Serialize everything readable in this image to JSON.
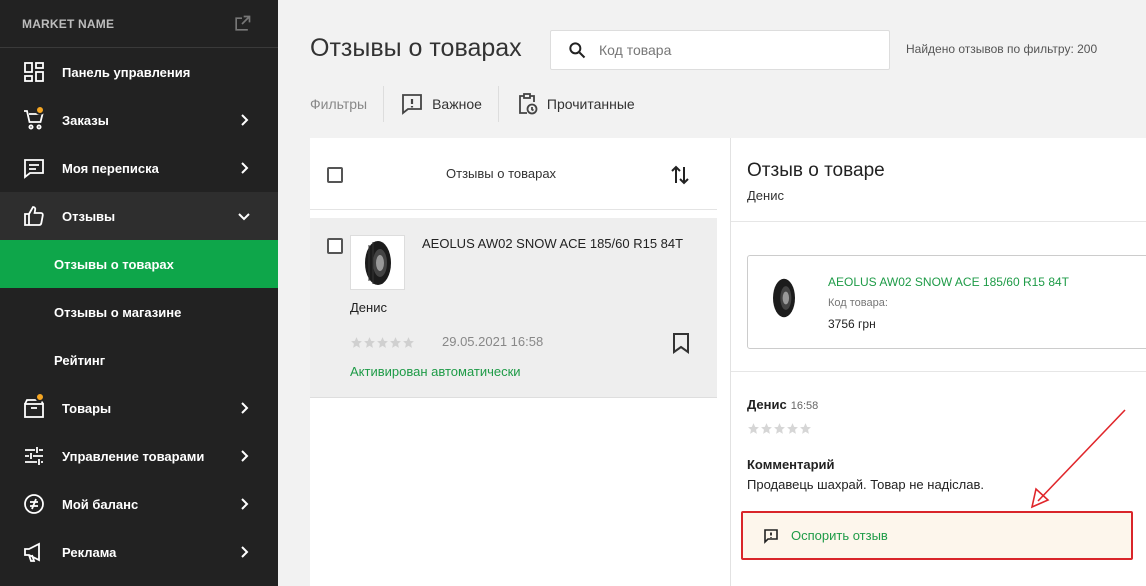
{
  "sidebar": {
    "market_name": "MARKET NAME",
    "items": [
      {
        "label": "Панель управления",
        "icon": "dashboard-icon"
      },
      {
        "label": "Заказы",
        "icon": "cart-icon"
      },
      {
        "label": "Моя переписка",
        "icon": "chat-icon"
      },
      {
        "label": "Отзывы",
        "icon": "thumb-up-icon"
      },
      {
        "label": "Товары",
        "icon": "box-icon"
      },
      {
        "label": "Управление товарами",
        "icon": "sliders-icon"
      },
      {
        "label": "Мой баланс",
        "icon": "balance-icon"
      },
      {
        "label": "Реклама",
        "icon": "megaphone-icon"
      }
    ],
    "sub_items": [
      {
        "label": "Отзывы о товарах"
      },
      {
        "label": "Отзывы о магазине"
      },
      {
        "label": "Рейтинг"
      }
    ]
  },
  "page": {
    "title": "Отзывы о товарах",
    "search_placeholder": "Код товара",
    "found_text": "Найдено отзывов по фильтру: 200"
  },
  "filters": {
    "label": "Фильтры",
    "important": "Важное",
    "read": "Прочитанные"
  },
  "list": {
    "header": "Отзывы о товарах",
    "rows": [
      {
        "product": "AEOLUS AW02 SNOW ACE 185/60 R15 84T",
        "author": "Денис",
        "rating": 0,
        "date": "29.05.2021 16:58",
        "status": "Активирован автоматически"
      }
    ]
  },
  "detail": {
    "title": "Отзыв о товаре",
    "author": "Денис",
    "product_name": "AEOLUS AW02 SNOW ACE 185/60 R15 84T",
    "product_code_label": "Код товара:",
    "price": "3756 грн",
    "review_author": "Денис",
    "review_time": "16:58",
    "rating": 0,
    "comment_label": "Комментарий",
    "comment": "Продавець шахрай. Товар не надіслав.",
    "dispute_button": "Оспорить отзыв"
  },
  "colors": {
    "sidebar_bg": "#222222",
    "active_green": "#0ea64a",
    "link_green": "#1e9b47",
    "badge_orange": "#f5a623",
    "highlight_red": "#d9252a"
  }
}
